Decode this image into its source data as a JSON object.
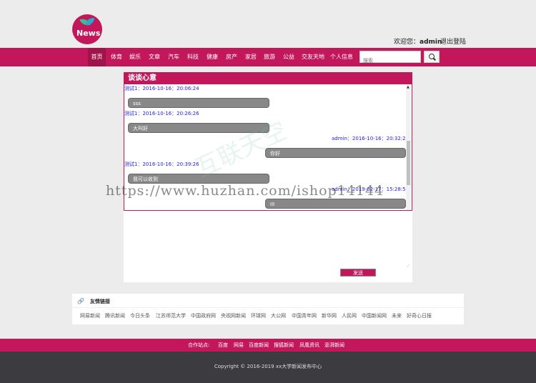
{
  "logo": {
    "text": "News"
  },
  "header": {
    "welcome_prefix": "欢迎您：",
    "username": "admin",
    "logout": "退出登陆"
  },
  "nav": {
    "items": [
      "首页",
      "体育",
      "娱乐",
      "文章",
      "汽车",
      "科技",
      "健康",
      "房产",
      "家居",
      "旅游",
      "公益",
      "交友天地",
      "个人信息"
    ],
    "active_index": 0,
    "search_placeholder": "搜索"
  },
  "chat": {
    "title": "谈谈心意",
    "messages": [
      {
        "meta": "测试1：2016-10-16：20:06:24",
        "text": "sss",
        "side": "left"
      },
      {
        "meta": "测试1：2016-10-16：20:26:26",
        "text": "大叫好",
        "side": "left"
      },
      {
        "meta": "admin：2016-10-16：20:32:26",
        "text": "你好",
        "side": "right"
      },
      {
        "meta": "测试1：2016-10-16：20:39:26",
        "text": "我可以收到",
        "side": "left"
      },
      {
        "meta": "admin：2019-02-17：15:28:50",
        "text": "III",
        "side": "right"
      }
    ],
    "send_label": "发送"
  },
  "links": {
    "title": "友情链接",
    "items": [
      "网易新闻",
      "腾讯新闻",
      "今日头条",
      "江苏师范大学",
      "中国政府网",
      "央视网新闻",
      "环球网",
      "大公网",
      "中国青年网",
      "新华网",
      "人民网",
      "中国新闻网",
      "未来",
      "好奇心日报"
    ]
  },
  "footer": {
    "partners_label": "合作站点:",
    "partners": [
      "百度",
      "网易",
      "百度新闻",
      "搜狐新闻",
      "凤凰资讯",
      "澎湃新闻"
    ],
    "copyright": "Copyright © 2016-2019 xx大学新闻发布中心"
  },
  "watermark": {
    "text": "https://www.huzhan.com/ishop14144",
    "faint": "互联天空"
  },
  "colors": {
    "brand": "#c2185b",
    "footer_dark": "#3b3b40",
    "meta_blue": "#2222dd",
    "bubble_gray": "#888888"
  }
}
